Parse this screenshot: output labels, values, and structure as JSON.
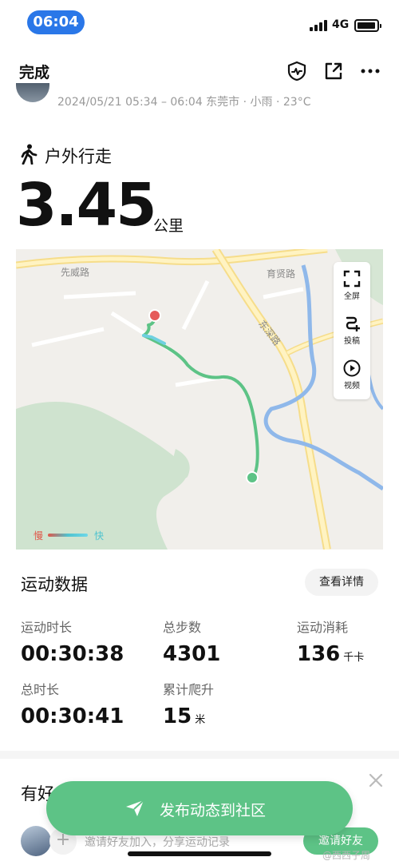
{
  "status": {
    "time": "06:04",
    "network": "4G",
    "time_pill_color": "#2a77e8"
  },
  "nav": {
    "done_label": "完成",
    "icons": [
      "shield-heart-icon",
      "share-out-icon",
      "more-icon"
    ]
  },
  "activity": {
    "meta": "2024/05/21 05:34 – 06:04 东莞市 · 小雨 · 23°C",
    "sport_type": "户外行走",
    "distance": "3.45",
    "distance_unit": "公里"
  },
  "map": {
    "road_labels": [
      "先威路",
      "育贤路",
      "东深路"
    ],
    "tools": [
      {
        "icon": "fullscreen-icon",
        "label": "全屏"
      },
      {
        "icon": "post-icon",
        "label": "投稿"
      },
      {
        "icon": "video-play-icon",
        "label": "视频"
      }
    ],
    "legend_slow": "慢",
    "legend_fast": "快",
    "route_color": "#5dc386",
    "start_color": "#5dc386",
    "end_color": "#e55a5a"
  },
  "data_section": {
    "title": "运动数据",
    "detail_button": "查看详情",
    "stats": [
      {
        "label": "运动时长",
        "value": "00:30:38",
        "unit": ""
      },
      {
        "label": "总步数",
        "value": "4301",
        "unit": ""
      },
      {
        "label": "运动消耗",
        "value": "136",
        "unit": "千卡"
      },
      {
        "label": "总时长",
        "value": "00:30:41",
        "unit": ""
      },
      {
        "label": "累计爬升",
        "value": "15",
        "unit": "米"
      }
    ]
  },
  "friends": {
    "title": "有好",
    "publish_label": "发布动态到社区",
    "invite_text": "邀请好友加入，分享运动记录",
    "invite_button": "邀请好友",
    "plus": "+",
    "watermark": "@西西子周"
  },
  "colors": {
    "accent_green": "#5dc386"
  }
}
